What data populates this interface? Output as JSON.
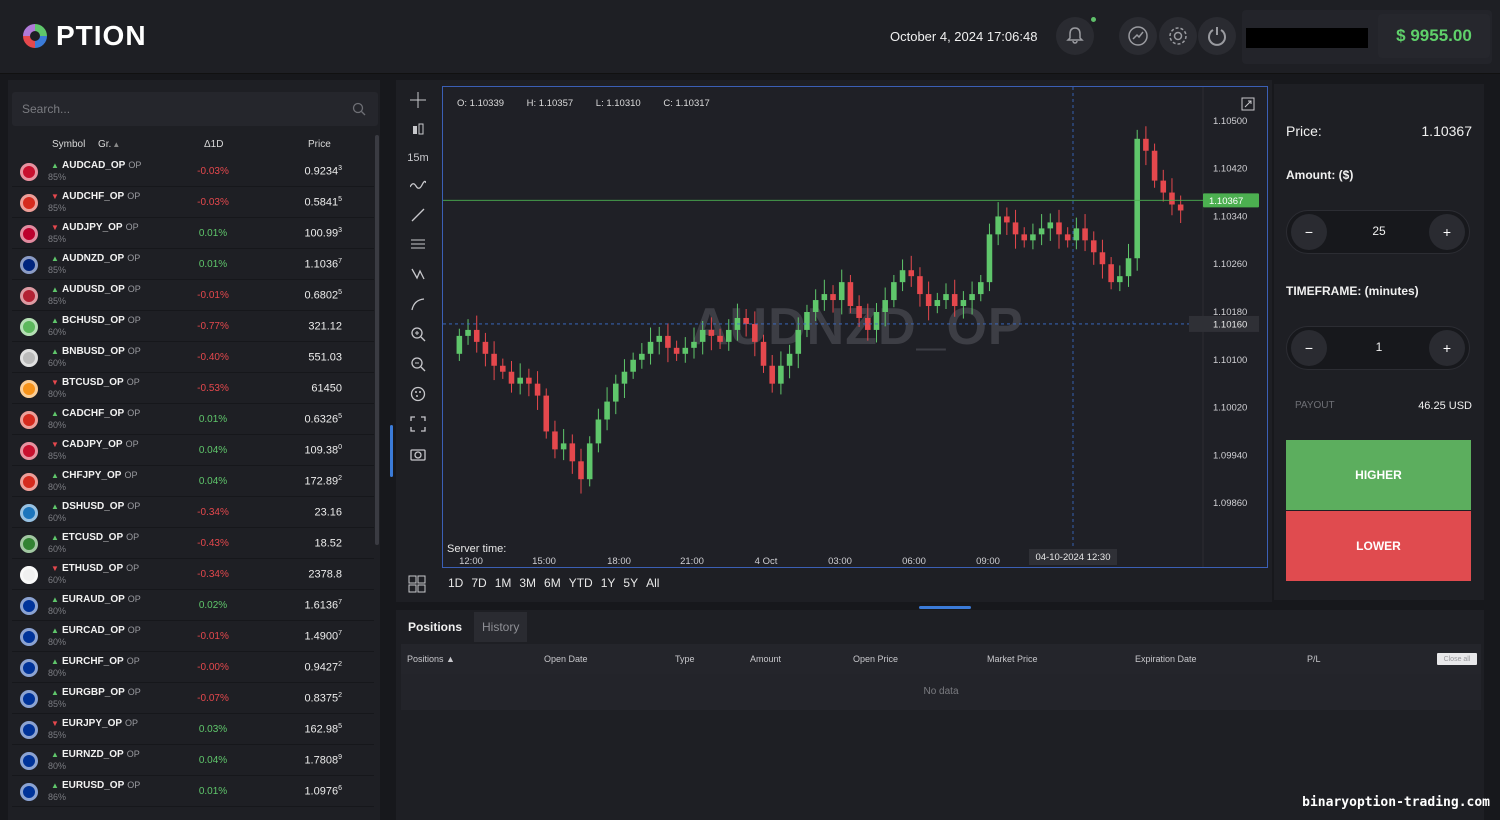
{
  "header": {
    "logo_text": "PTION",
    "datetime": "October 4, 2024 17:06:48",
    "balance": "$ 9955.00"
  },
  "search": {
    "placeholder": "Search..."
  },
  "asset_list": {
    "columns": {
      "symbol": "Symbol",
      "group": "Gr.",
      "change": "Δ1D",
      "price": "Price"
    },
    "rows": [
      {
        "symbol": "AUDCAD_OP",
        "tag": "OP",
        "payout": "85%",
        "change": "-0.03%",
        "dir": "up",
        "price_main": "0.9234",
        "price_sup": "3",
        "flag": "#c8102e"
      },
      {
        "symbol": "AUDCHF_OP",
        "tag": "OP",
        "payout": "85%",
        "change": "-0.03%",
        "dir": "down",
        "price_main": "0.5841",
        "price_sup": "5",
        "flag": "#d52b1e"
      },
      {
        "symbol": "AUDJPY_OP",
        "tag": "OP",
        "payout": "85%",
        "change": "0.01%",
        "dir": "down",
        "price_main": "100.99",
        "price_sup": "3",
        "flag": "#bc002d"
      },
      {
        "symbol": "AUDNZD_OP",
        "tag": "OP",
        "payout": "85%",
        "change": "0.01%",
        "dir": "up",
        "price_main": "1.1036",
        "price_sup": "7",
        "flag": "#00247d"
      },
      {
        "symbol": "AUDUSD_OP",
        "tag": "OP",
        "payout": "85%",
        "change": "-0.01%",
        "dir": "up",
        "price_main": "0.6802",
        "price_sup": "5",
        "flag": "#b22234"
      },
      {
        "symbol": "BCHUSD_OP",
        "tag": "OP",
        "payout": "60%",
        "change": "-0.77%",
        "dir": "up",
        "price_main": "321.12",
        "price_sup": "",
        "flag": "#5cb85c"
      },
      {
        "symbol": "BNBUSD_OP",
        "tag": "OP",
        "payout": "60%",
        "change": "-0.40%",
        "dir": "up",
        "price_main": "551.03",
        "price_sup": "",
        "flag": "#bbbbbb"
      },
      {
        "symbol": "BTCUSD_OP",
        "tag": "OP",
        "payout": "80%",
        "change": "-0.53%",
        "dir": "down",
        "price_main": "61450",
        "price_sup": "",
        "flag": "#f7931a"
      },
      {
        "symbol": "CADCHF_OP",
        "tag": "OP",
        "payout": "80%",
        "change": "0.01%",
        "dir": "up",
        "price_main": "0.6326",
        "price_sup": "5",
        "flag": "#d52b1e"
      },
      {
        "symbol": "CADJPY_OP",
        "tag": "OP",
        "payout": "85%",
        "change": "0.04%",
        "dir": "down",
        "price_main": "109.38",
        "price_sup": "0",
        "flag": "#c8102e"
      },
      {
        "symbol": "CHFJPY_OP",
        "tag": "OP",
        "payout": "80%",
        "change": "0.04%",
        "dir": "up",
        "price_main": "172.89",
        "price_sup": "2",
        "flag": "#d52b1e"
      },
      {
        "symbol": "DSHUSD_OP",
        "tag": "OP",
        "payout": "60%",
        "change": "-0.34%",
        "dir": "up",
        "price_main": "23.16",
        "price_sup": "",
        "flag": "#1c75bc"
      },
      {
        "symbol": "ETCUSD_OP",
        "tag": "OP",
        "payout": "60%",
        "change": "-0.43%",
        "dir": "up",
        "price_main": "18.52",
        "price_sup": "",
        "flag": "#328332"
      },
      {
        "symbol": "ETHUSD_OP",
        "tag": "OP",
        "payout": "60%",
        "change": "-0.34%",
        "dir": "down",
        "price_main": "2378.8",
        "price_sup": "",
        "flag": "#f0f0f0"
      },
      {
        "symbol": "EURAUD_OP",
        "tag": "OP",
        "payout": "80%",
        "change": "0.02%",
        "dir": "up",
        "price_main": "1.6136",
        "price_sup": "7",
        "flag": "#003399"
      },
      {
        "symbol": "EURCAD_OP",
        "tag": "OP",
        "payout": "80%",
        "change": "-0.01%",
        "dir": "up",
        "price_main": "1.4900",
        "price_sup": "7",
        "flag": "#003399"
      },
      {
        "symbol": "EURCHF_OP",
        "tag": "OP",
        "payout": "80%",
        "change": "-0.00%",
        "dir": "up",
        "price_main": "0.9427",
        "price_sup": "2",
        "flag": "#003399"
      },
      {
        "symbol": "EURGBP_OP",
        "tag": "OP",
        "payout": "85%",
        "change": "-0.07%",
        "dir": "up",
        "price_main": "0.8375",
        "price_sup": "2",
        "flag": "#003399"
      },
      {
        "symbol": "EURJPY_OP",
        "tag": "OP",
        "payout": "85%",
        "change": "0.03%",
        "dir": "down",
        "price_main": "162.98",
        "price_sup": "5",
        "flag": "#003399"
      },
      {
        "symbol": "EURNZD_OP",
        "tag": "OP",
        "payout": "80%",
        "change": "0.04%",
        "dir": "up",
        "price_main": "1.7808",
        "price_sup": "9",
        "flag": "#003399"
      },
      {
        "symbol": "EURUSD_OP",
        "tag": "OP",
        "payout": "86%",
        "change": "0.01%",
        "dir": "up",
        "price_main": "1.0976",
        "price_sup": "6",
        "flag": "#003399"
      }
    ]
  },
  "toolbar": {
    "interval": "15m"
  },
  "chart": {
    "ohlc": {
      "open": "O: 1.10339",
      "high": "H: 1.10357",
      "low": "L: 1.10310",
      "close": "C: 1.10317"
    },
    "watermark": "AUDNZD_OP",
    "server_time_label": "Server time:",
    "crosshair_time": "04-10-2024 12:30",
    "current_price_label": "1.10367",
    "crosshair_price_label": "1.10160",
    "ranges": [
      "1D",
      "7D",
      "1M",
      "3M",
      "6M",
      "YTD",
      "1Y",
      "5Y",
      "All"
    ]
  },
  "chart_data": {
    "type": "candlestick",
    "x_ticks": [
      "12:00",
      "15:00",
      "18:00",
      "21:00",
      "4 Oct",
      "03:00",
      "06:00",
      "09:00"
    ],
    "y_ticks": [
      "1.10500",
      "1.10420",
      "1.10340",
      "1.10260",
      "1.10180",
      "1.10100",
      "1.10020",
      "1.09940",
      "1.09860"
    ],
    "ylim": [
      1.0982,
      1.1054
    ],
    "current_price": 1.10367,
    "crosshair_price": 1.1016,
    "close_path": [
      1.1014,
      1.1015,
      1.1013,
      1.1011,
      1.1009,
      1.1008,
      1.1006,
      1.1007,
      1.1006,
      1.1004,
      1.0998,
      1.0995,
      1.0996,
      1.0993,
      1.099,
      1.0996,
      1.1,
      1.1003,
      1.1006,
      1.1008,
      1.101,
      1.1011,
      1.1013,
      1.1014,
      1.1012,
      1.1011,
      1.1012,
      1.1013,
      1.1015,
      1.1014,
      1.1013,
      1.1015,
      1.1017,
      1.1016,
      1.1013,
      1.1009,
      1.1006,
      1.1009,
      1.1011,
      1.1015,
      1.1018,
      1.102,
      1.1021,
      1.102,
      1.1023,
      1.1019,
      1.1017,
      1.1015,
      1.1018,
      1.102,
      1.1023,
      1.1025,
      1.1024,
      1.1021,
      1.1019,
      1.102,
      1.1021,
      1.1019,
      1.102,
      1.1021,
      1.1023,
      1.1031,
      1.1034,
      1.1033,
      1.1031,
      1.103,
      1.1031,
      1.1032,
      1.1033,
      1.1031,
      1.103,
      1.1032,
      1.103,
      1.1028,
      1.1026,
      1.1023,
      1.1024,
      1.1027,
      1.1047,
      1.1045,
      1.104,
      1.1038,
      1.1036,
      1.1035
    ]
  },
  "trade": {
    "price_label": "Price:",
    "price_value": "1.10367",
    "amount_label": "Amount: ($)",
    "amount_value": "25",
    "timeframe_label": "TIMEFRAME: (minutes)",
    "timeframe_value": "1",
    "minus": "−",
    "plus": "+",
    "payout_label": "PAYOUT",
    "payout_value": "46.25 USD",
    "higher_label": "HIGHER",
    "lower_label": "LOWER"
  },
  "positions": {
    "tab_positions": "Positions",
    "tab_history": "History",
    "columns": [
      "Positions ▲",
      "Open Date",
      "Type",
      "Amount",
      "Open Price",
      "Market Price",
      "Expiration Date",
      "P/L"
    ],
    "close_all": "Close all",
    "empty_text": "No data"
  },
  "brand_mark": "binaryoption-trading.com",
  "colors": {
    "up": "#5fc66b",
    "down": "#e5484d",
    "accent": "#3b7bd8",
    "higher": "#5cae5e",
    "lower": "#e04b4f"
  }
}
